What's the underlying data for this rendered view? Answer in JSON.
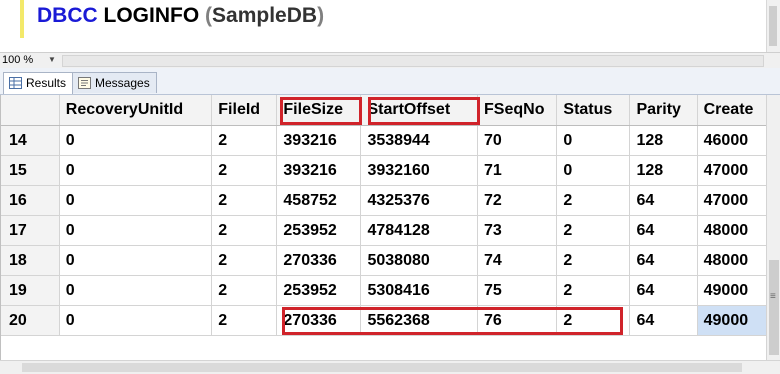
{
  "editor": {
    "keyword": "DBCC",
    "command": "LOGINFO",
    "open_paren": "(",
    "database": "SampleDB",
    "close_paren": ")"
  },
  "zoom": {
    "value": "100 %"
  },
  "tabs": [
    {
      "label": "Results",
      "icon": "grid-icon"
    },
    {
      "label": "Messages",
      "icon": "messages-icon"
    }
  ],
  "grid": {
    "columns": [
      "",
      "RecoveryUnitId",
      "FileId",
      "FileSize",
      "StartOffset",
      "FSeqNo",
      "Status",
      "Parity",
      "Create"
    ],
    "rows": [
      [
        "14",
        "0",
        "2",
        "393216",
        "3538944",
        "70",
        "0",
        "128",
        "46000"
      ],
      [
        "15",
        "0",
        "2",
        "393216",
        "3932160",
        "71",
        "0",
        "128",
        "47000"
      ],
      [
        "16",
        "0",
        "2",
        "458752",
        "4325376",
        "72",
        "2",
        "64",
        "47000"
      ],
      [
        "17",
        "0",
        "2",
        "253952",
        "4784128",
        "73",
        "2",
        "64",
        "48000"
      ],
      [
        "18",
        "0",
        "2",
        "270336",
        "5038080",
        "74",
        "2",
        "64",
        "48000"
      ],
      [
        "19",
        "0",
        "2",
        "253952",
        "5308416",
        "75",
        "2",
        "64",
        "49000"
      ],
      [
        "20",
        "0",
        "2",
        "270336",
        "5562368",
        "76",
        "2",
        "64",
        "49000"
      ]
    ],
    "highlighted_headers": [
      "FileSize",
      "StartOffset"
    ],
    "highlight_color": "#d0232a",
    "selected_cell_color": "#cfe0f5"
  }
}
